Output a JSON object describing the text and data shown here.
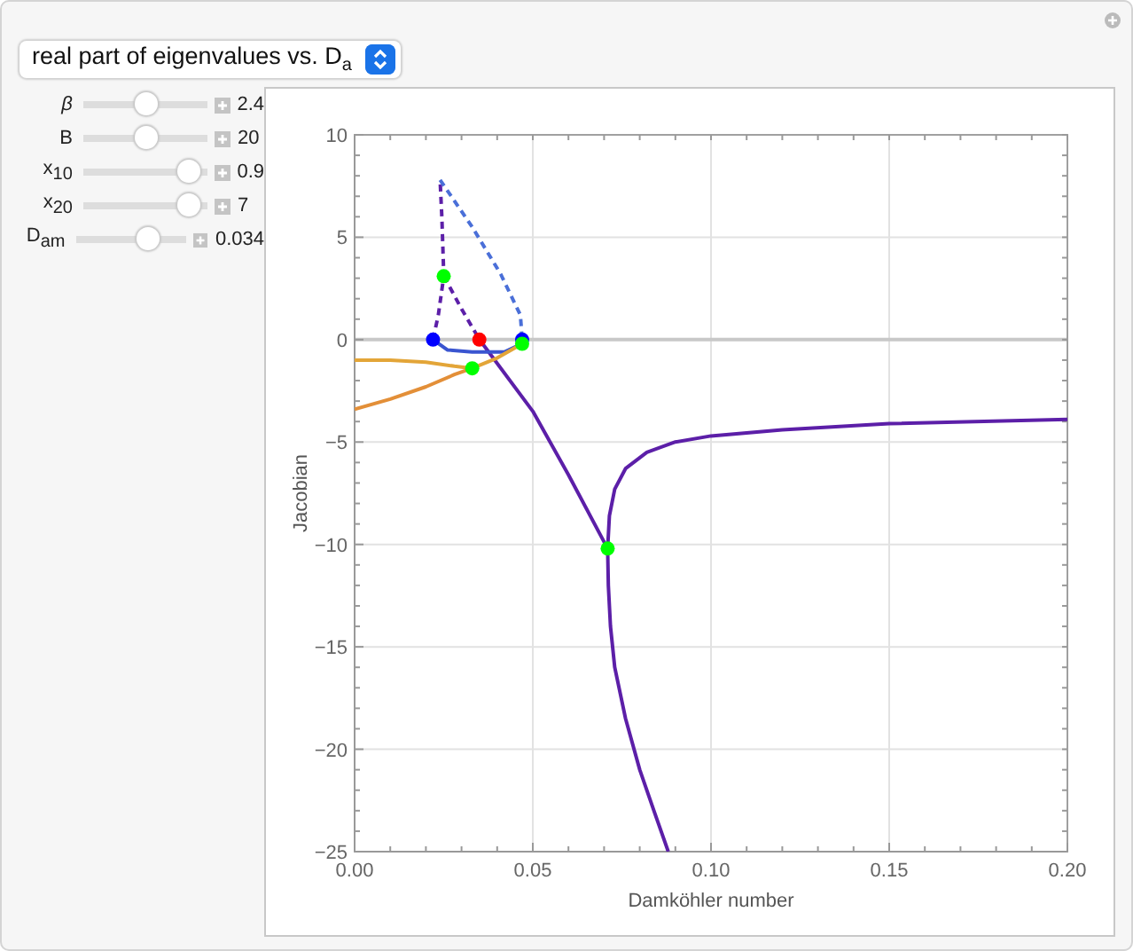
{
  "popup": {
    "label": "real part of eigenvalues vs. D$_{a}$"
  },
  "controls": [
    {
      "label": "β",
      "italic": true,
      "level": 0.5,
      "value": "2.4"
    },
    {
      "label": "B",
      "italic": false,
      "level": 0.5,
      "value": "20"
    },
    {
      "label": "x$_{10}$",
      "italic": false,
      "level": 0.84,
      "value": "0.9"
    },
    {
      "label": "x$_{20}$",
      "italic": false,
      "level": 0.84,
      "value": "7"
    },
    {
      "label": "D$_{am}$",
      "italic": false,
      "level": 0.64,
      "value": "0.034"
    }
  ],
  "plot": {
    "chart_data": {
      "type": "line",
      "xlabel": "Damköhler number",
      "ylabel": "Jacobian",
      "xlim": [
        0,
        0.2
      ],
      "ylim": [
        -25,
        10
      ],
      "grid": true,
      "xticks": [
        {
          "value": 0,
          "label": "0.00"
        },
        {
          "value": 0.05,
          "label": "0.05"
        },
        {
          "value": 0.1,
          "label": "0.10"
        },
        {
          "value": 0.15,
          "label": "0.15"
        },
        {
          "value": 0.2,
          "label": "0.20"
        }
      ],
      "yticks": [
        {
          "value": 10,
          "label": "10"
        },
        {
          "value": 5,
          "label": "5"
        },
        {
          "value": 0,
          "label": "0"
        },
        {
          "value": -5,
          "label": "−5"
        },
        {
          "value": -10,
          "label": "−10"
        },
        {
          "value": -15,
          "label": "−15"
        },
        {
          "value": -20,
          "label": "−20"
        },
        {
          "value": -25,
          "label": "−25"
        }
      ],
      "series": [
        {
          "color": "#5c1fa8",
          "line_style": "solid",
          "x": [
            0.035,
            0.05,
            0.06,
            0.071,
            0.0712,
            0.0718,
            0.073,
            0.076,
            0.08,
            0.084,
            0.088
          ],
          "values": [
            0,
            -3.5,
            -6.6,
            -10.2,
            -12,
            -14,
            -16,
            -18.5,
            -21,
            -23,
            -25
          ]
        },
        {
          "color": "#5c1fa8",
          "line_style": "solid",
          "x": [
            0.071,
            0.0715,
            0.073,
            0.076,
            0.082,
            0.09,
            0.1,
            0.12,
            0.15,
            0.2
          ],
          "values": [
            -10.2,
            -8.6,
            -7.3,
            -6.3,
            -5.5,
            -5,
            -4.7,
            -4.4,
            -4.1,
            -3.9
          ]
        },
        {
          "color": "#5c1fa8",
          "line_style": "dashed",
          "x": [
            0.022,
            0.0235,
            0.025,
            0.0245,
            0.024
          ],
          "values": [
            0,
            1.2,
            3.1,
            6,
            7.8
          ]
        },
        {
          "color": "#5c1fa8",
          "line_style": "dashed",
          "x": [
            0.025,
            0.03,
            0.035
          ],
          "values": [
            3.1,
            1.5,
            0
          ]
        },
        {
          "color": "#4a6fd8",
          "line_style": "dashed",
          "x": [
            0.024,
            0.033,
            0.041,
            0.0465,
            0.047
          ],
          "values": [
            7.8,
            5.5,
            3.2,
            1.2,
            0
          ]
        },
        {
          "color": "#3a55d0",
          "line_style": "solid",
          "x": [
            0.022,
            0.026,
            0.033,
            0.042,
            0.047
          ],
          "values": [
            0,
            -0.5,
            -0.6,
            -0.6,
            -0.2
          ]
        },
        {
          "color": "#e3a538",
          "line_style": "solid",
          "x": [
            0,
            0.01,
            0.02,
            0.028,
            0.033,
            0.04,
            0.047
          ],
          "values": [
            -1,
            -1,
            -1.1,
            -1.3,
            -1.4,
            -0.9,
            -0.2
          ]
        },
        {
          "color": "#e38f38",
          "line_style": "solid",
          "x": [
            0,
            0.01,
            0.02,
            0.028,
            0.033
          ],
          "values": [
            -3.4,
            -2.9,
            -2.3,
            -1.7,
            -1.4
          ]
        },
        {
          "color": "#0000ff",
          "type": "scatter",
          "marker": "circle",
          "x": [
            0.022,
            0.047
          ],
          "values": [
            0,
            0
          ]
        },
        {
          "color": "#ff0000",
          "type": "scatter",
          "marker": "circle",
          "x": [
            0.035
          ],
          "values": [
            0
          ]
        },
        {
          "color": "#00ff00",
          "type": "scatter",
          "marker": "circle",
          "x": [
            0.025,
            0.033,
            0.047,
            0.071
          ],
          "values": [
            3.1,
            -1.4,
            -0.2,
            -10.2
          ]
        }
      ]
    }
  }
}
